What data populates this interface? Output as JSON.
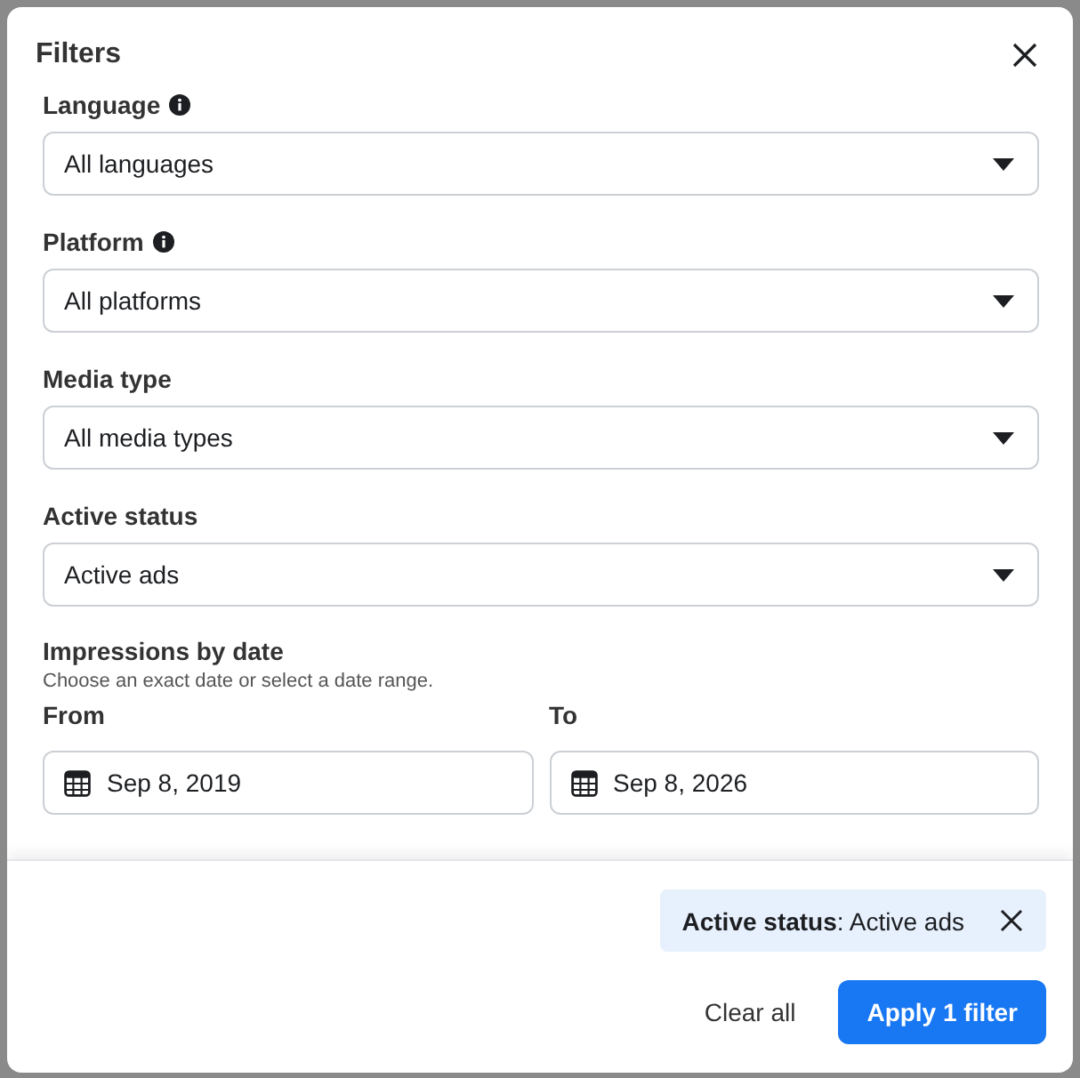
{
  "dialog": {
    "title": "Filters"
  },
  "selects": [
    {
      "label": "Language",
      "info": true,
      "value": "All languages"
    },
    {
      "label": "Platform",
      "info": true,
      "value": "All platforms"
    },
    {
      "label": "Media type",
      "info": false,
      "value": "All media types"
    },
    {
      "label": "Active status",
      "info": false,
      "value": "Active ads"
    }
  ],
  "dates": {
    "title": "Impressions by date",
    "hint": "Choose an exact date or select a date range.",
    "fields": [
      {
        "label": "From",
        "value": "Sep 8, 2019"
      },
      {
        "label": "To",
        "value": "Sep 8, 2026"
      }
    ]
  },
  "applied_filters": [
    {
      "text": "**Active status**: Active ads"
    }
  ],
  "buttons": {
    "clear": "Clear all",
    "apply": "Apply 1 filter"
  }
}
